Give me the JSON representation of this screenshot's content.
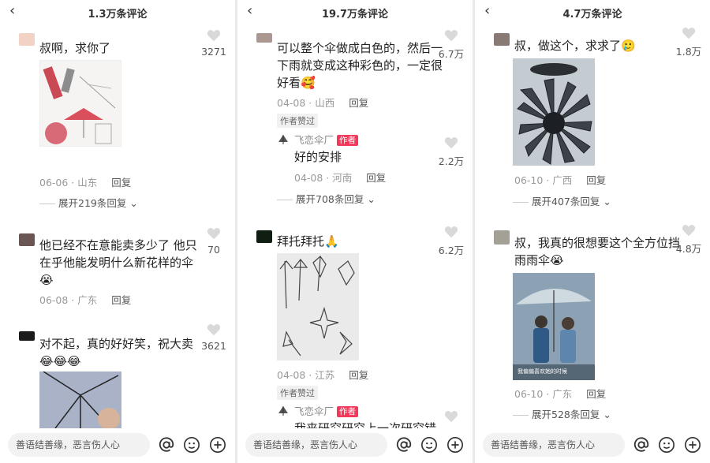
{
  "panels": [
    {
      "title": "1.3万条评论",
      "comments": [
        {
          "text": "叔啊，求你了",
          "likes": "3271",
          "date": "06-06",
          "location": "山东",
          "reply": "回复",
          "expand": "展开219条回复"
        },
        {
          "text": "他已经不在意能卖多少了 他只在乎他能发明什么新花样的伞😭",
          "likes": "70",
          "date": "06-08",
          "location": "广东",
          "reply": "回复"
        },
        {
          "text": "对不起，真的好好笑，祝大卖😂😂😂",
          "likes": "3621"
        }
      ]
    },
    {
      "title": "19.7万条评论",
      "comments": [
        {
          "text": "可以整个伞做成白色的，然后一下雨就变成这种彩色的，一定很好看🥰",
          "likes": "6.7万",
          "date": "04-08",
          "location": "山西",
          "reply": "回复",
          "badge": "作者赞过",
          "sub": {
            "name": "飞恋伞厂",
            "tag": "作者",
            "text": "好的安排",
            "likes": "2.2万",
            "date": "04-08",
            "location": "河南",
            "reply": "回复",
            "expand": "展开708条回复"
          }
        },
        {
          "text": "拜托拜托🙏",
          "likes": "6.2万",
          "date": "04-08",
          "location": "江苏",
          "reply": "回复",
          "badge": "作者赞过",
          "sub": {
            "name": "飞恋伞厂",
            "tag": "作者",
            "text": "我来研究研究上一次研究错"
          }
        }
      ]
    },
    {
      "title": "4.7万条评论",
      "comments": [
        {
          "text": "叔，做这个，求求了🥲",
          "likes": "1.8万",
          "date": "06-10",
          "location": "广西",
          "reply": "回复",
          "expand": "展开407条回复"
        },
        {
          "text": "叔，我真的很想要这个全方位挡雨雨伞😭",
          "likes": "4.8万",
          "date": "06-10",
          "location": "广东",
          "reply": "回复",
          "expand": "展开528条回复",
          "img_caption": "我偏偏喜欢她的时候"
        }
      ]
    }
  ],
  "input": {
    "placeholder": "善语结善缘，恶言伤人心"
  },
  "icons": {
    "back": "back-arrow-icon",
    "like": "heart-icon",
    "mention": "at-icon",
    "emoji": "smiley-icon",
    "add": "plus-icon"
  },
  "colors": {
    "author_tag": "#f4385c",
    "meta": "#999999"
  }
}
